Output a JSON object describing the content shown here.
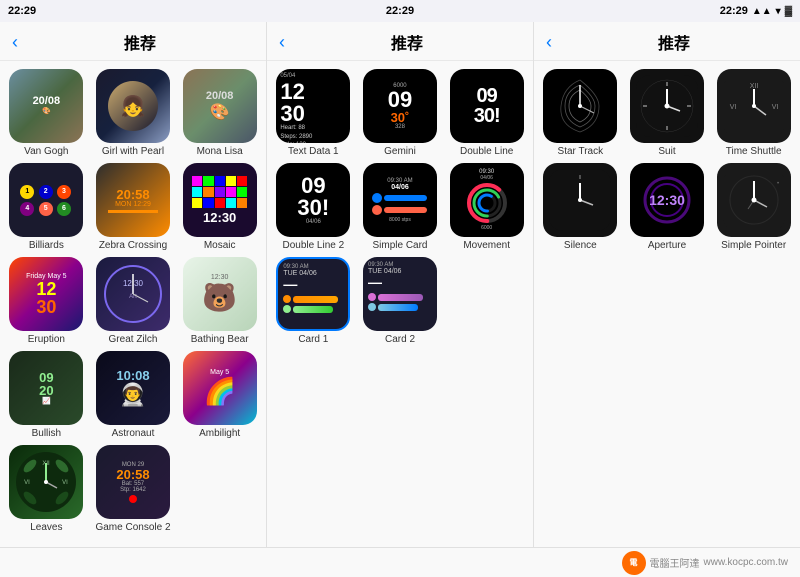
{
  "statusBar": {
    "time": "22:29",
    "signal": "▲▲▲",
    "wifi": "WiFi",
    "battery": "🔋"
  },
  "panels": [
    {
      "id": "panel1",
      "backLabel": "‹",
      "title": "推荐",
      "items": [
        {
          "id": "van-gogh",
          "label": "Van Gogh",
          "type": "art"
        },
        {
          "id": "girl-pearl",
          "label": "Girl with Pearl",
          "type": "art"
        },
        {
          "id": "mona-lisa",
          "label": "Mona Lisa",
          "type": "art"
        },
        {
          "id": "billiards",
          "label": "Billiards",
          "type": "game"
        },
        {
          "id": "zebra-crossing",
          "label": "Zebra Crossing",
          "type": "pattern"
        },
        {
          "id": "mosaic",
          "label": "Mosaic",
          "type": "pattern"
        },
        {
          "id": "eruption",
          "label": "Eruption",
          "type": "colorful"
        },
        {
          "id": "great-zilch",
          "label": "Great Zilch",
          "type": "art"
        },
        {
          "id": "bathing-bear",
          "label": "Bathing Bear",
          "type": "cute"
        },
        {
          "id": "bullish",
          "label": "Bullish",
          "type": "art"
        },
        {
          "id": "astronaut",
          "label": "Astronaut",
          "type": "space"
        },
        {
          "id": "ambilight",
          "label": "Ambilight",
          "type": "colorful"
        },
        {
          "id": "leaves",
          "label": "Leaves",
          "type": "nature"
        },
        {
          "id": "game-console-2",
          "label": "Game Console 2",
          "type": "game"
        }
      ]
    },
    {
      "id": "panel2",
      "backLabel": "‹",
      "title": "推荐",
      "items": [
        {
          "id": "text-data-1",
          "label": "Text Data 1",
          "type": "digital"
        },
        {
          "id": "gemini",
          "label": "Gemini",
          "type": "digital"
        },
        {
          "id": "double-line",
          "label": "Double Line",
          "type": "digital"
        },
        {
          "id": "double-line-2",
          "label": "Double Line 2",
          "type": "digital"
        },
        {
          "id": "simple-card",
          "label": "Simple Card",
          "type": "digital"
        },
        {
          "id": "movement",
          "label": "Movement",
          "type": "digital"
        },
        {
          "id": "card-1",
          "label": "Card 1",
          "type": "card"
        },
        {
          "id": "card-2",
          "label": "Card 2",
          "type": "card"
        }
      ]
    },
    {
      "id": "panel3",
      "backLabel": "‹",
      "title": "推荐",
      "items": [
        {
          "id": "star-track",
          "label": "Star Track",
          "type": "analog"
        },
        {
          "id": "suit",
          "label": "Suit",
          "type": "analog"
        },
        {
          "id": "time-shuttle",
          "label": "Time Shuttle",
          "type": "analog"
        },
        {
          "id": "silence",
          "label": "Silence",
          "type": "analog"
        },
        {
          "id": "aperture",
          "label": "Aperture",
          "type": "digital"
        },
        {
          "id": "simple-pointer",
          "label": "Simple Pointer",
          "type": "analog"
        }
      ]
    }
  ],
  "watermark": {
    "text": "電腦王阿達",
    "url": "www.kocpc.com.tw"
  }
}
